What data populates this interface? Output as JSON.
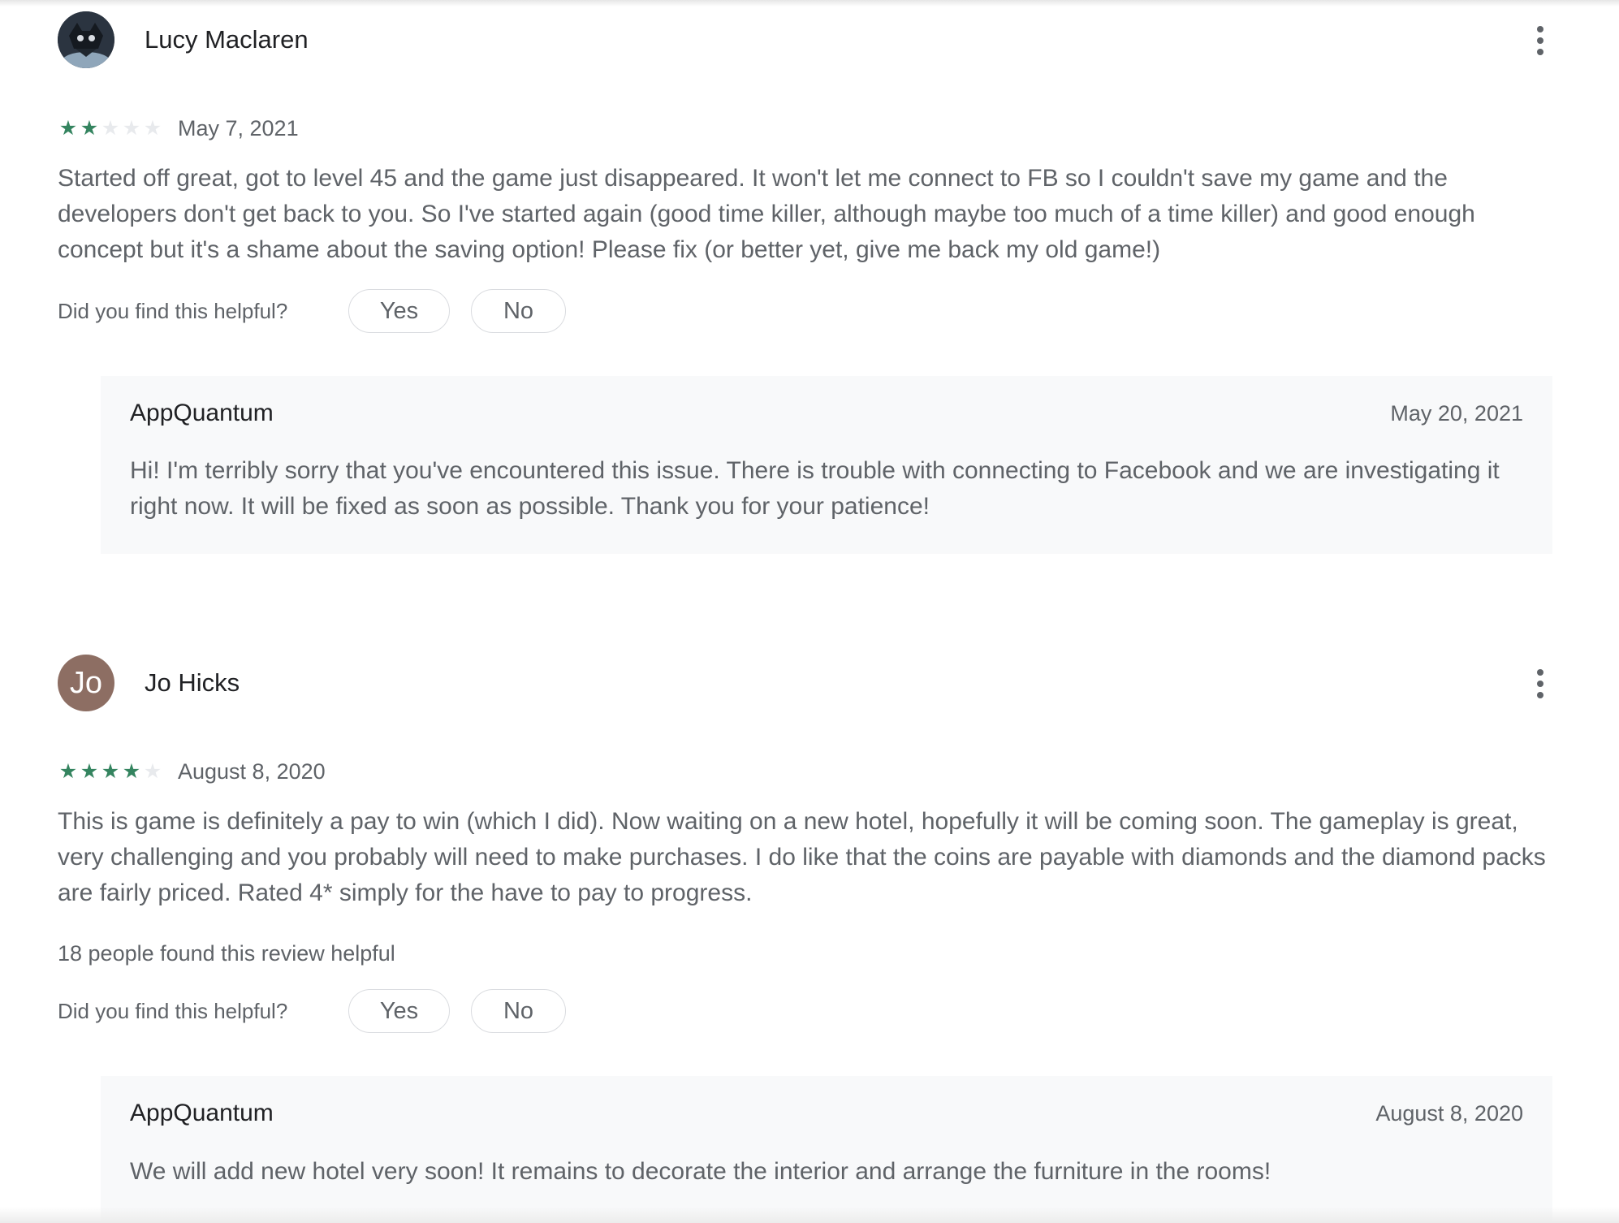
{
  "reviews": [
    {
      "author": "Lucy Maclaren",
      "avatar": {
        "type": "image",
        "icon": "profile-photo"
      },
      "rating": 2,
      "rating_max": 5,
      "date": "May 7, 2021",
      "text": "Started off great, got to level 45 and the game just disappeared. It won't let me connect to FB so I couldn't save my game and the developers don't get back to you. So I've started again (good time killer, although maybe too much of a time killer) and good enough concept but it's a shame about the saving option! Please fix (or better yet, give me back my old game!)",
      "helpful_count_text": "",
      "helpful_question": "Did you find this helpful?",
      "yes_label": "Yes",
      "no_label": "No",
      "reply": {
        "author": "AppQuantum",
        "date": "May 20, 2021",
        "text": "Hi! I'm terribly sorry that you've encountered this issue. There is trouble with connecting to Facebook and we are investigating it right now. It will be fixed as soon as possible. Thank you for your patience!"
      }
    },
    {
      "author": "Jo Hicks",
      "avatar": {
        "type": "initials",
        "initials": "Jo",
        "color": "#8d6e63"
      },
      "rating": 4,
      "rating_max": 5,
      "date": "August 8, 2020",
      "text": "This is game is definitely a pay to win (which I did). Now waiting on a new hotel, hopefully it will be coming soon. The gameplay is great, very challenging and you probably will need to make purchases. I do like that the coins are payable with diamonds and the diamond packs are fairly priced. Rated 4* simply for the have to pay to progress.",
      "helpful_count_text": "18 people found this review helpful",
      "helpful_question": "Did you find this helpful?",
      "yes_label": "Yes",
      "no_label": "No",
      "reply": {
        "author": "AppQuantum",
        "date": "August 8, 2020",
        "text": "We will add new hotel very soon! It remains to decorate the interior and arrange the furniture in the rooms!"
      }
    }
  ],
  "colors": {
    "star_filled": "#34845f",
    "star_empty": "#e8eaed",
    "reply_background": "#f8f9fa",
    "secondary_text": "#5f6368",
    "primary_text": "#202124"
  }
}
